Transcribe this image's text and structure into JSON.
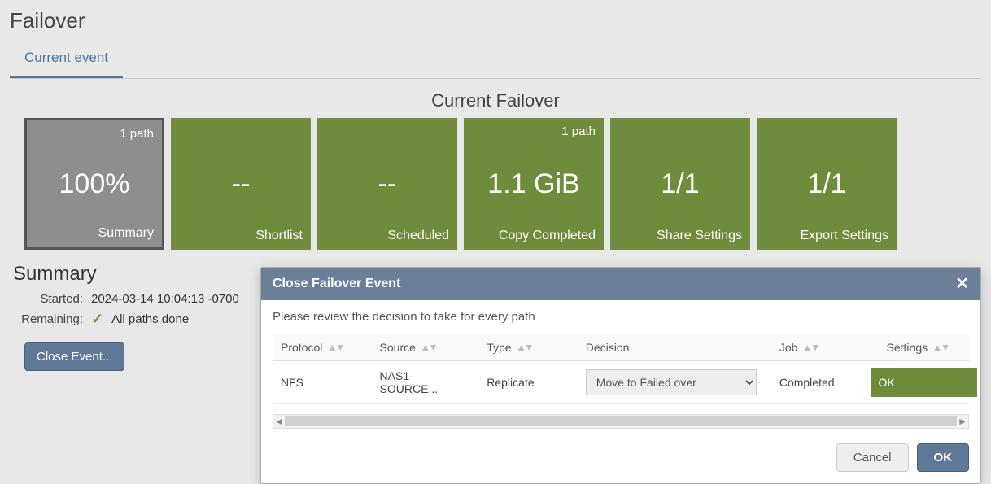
{
  "page": {
    "title": "Failover",
    "tab_current_event": "Current event",
    "section_title": "Current Failover"
  },
  "cards": {
    "summary": {
      "top": "1 path",
      "value": "100%",
      "label": "Summary"
    },
    "shortlist": {
      "top": "",
      "value": "--",
      "label": "Shortlist"
    },
    "scheduled": {
      "top": "",
      "value": "--",
      "label": "Scheduled"
    },
    "copy_completed": {
      "top": "1 path",
      "value": "1.1 GiB",
      "label": "Copy Completed"
    },
    "share_settings": {
      "top": "",
      "value": "1/1",
      "label": "Share Settings"
    },
    "export_settings": {
      "top": "",
      "value": "1/1",
      "label": "Export Settings"
    }
  },
  "summary": {
    "heading": "Summary",
    "started_label": "Started:",
    "started_value": "2024-03-14 10:04:13 -0700",
    "remaining_label": "Remaining:",
    "remaining_value": "All paths done",
    "close_event_button": "Close Event..."
  },
  "modal": {
    "title": "Close Failover Event",
    "subtitle": "Please review the decision to take for every path",
    "columns": {
      "protocol": "Protocol",
      "source": "Source",
      "type": "Type",
      "decision": "Decision",
      "job": "Job",
      "settings": "Settings"
    },
    "row": {
      "protocol": "NFS",
      "source": "NAS1-SOURCE...",
      "type": "Replicate",
      "decision_selected": "Move to Failed over",
      "job": "Completed",
      "settings": "OK"
    },
    "cancel": "Cancel",
    "ok": "OK"
  }
}
